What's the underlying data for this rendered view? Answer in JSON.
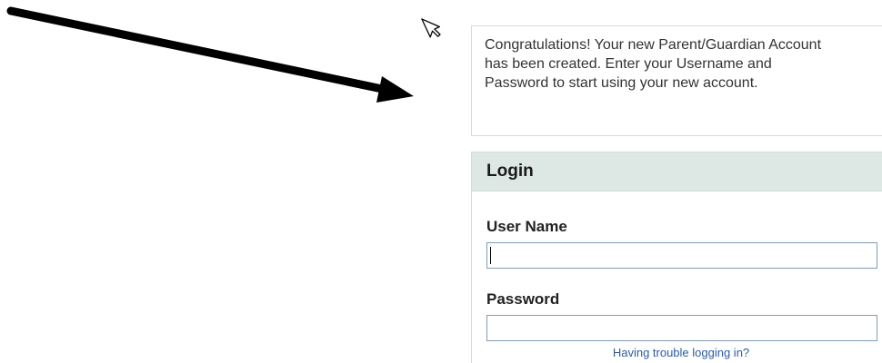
{
  "notice": {
    "message": "Congratulations! Your new Parent/Guardian Account has been created. Enter your Username and Password to start using your new account."
  },
  "login": {
    "title": "Login",
    "username_label": "User Name",
    "username_value": "",
    "password_label": "Password",
    "password_value": "",
    "trouble_link": "Having trouble logging in?"
  },
  "icons": {
    "annotation": "arrow-icon",
    "pointer": "mouse-cursor-icon"
  },
  "colors": {
    "header_bg": "#dde8e5",
    "panel_border": "#cfdcdc",
    "link": "#2a5ab8",
    "input_border": "#7f9db9"
  }
}
